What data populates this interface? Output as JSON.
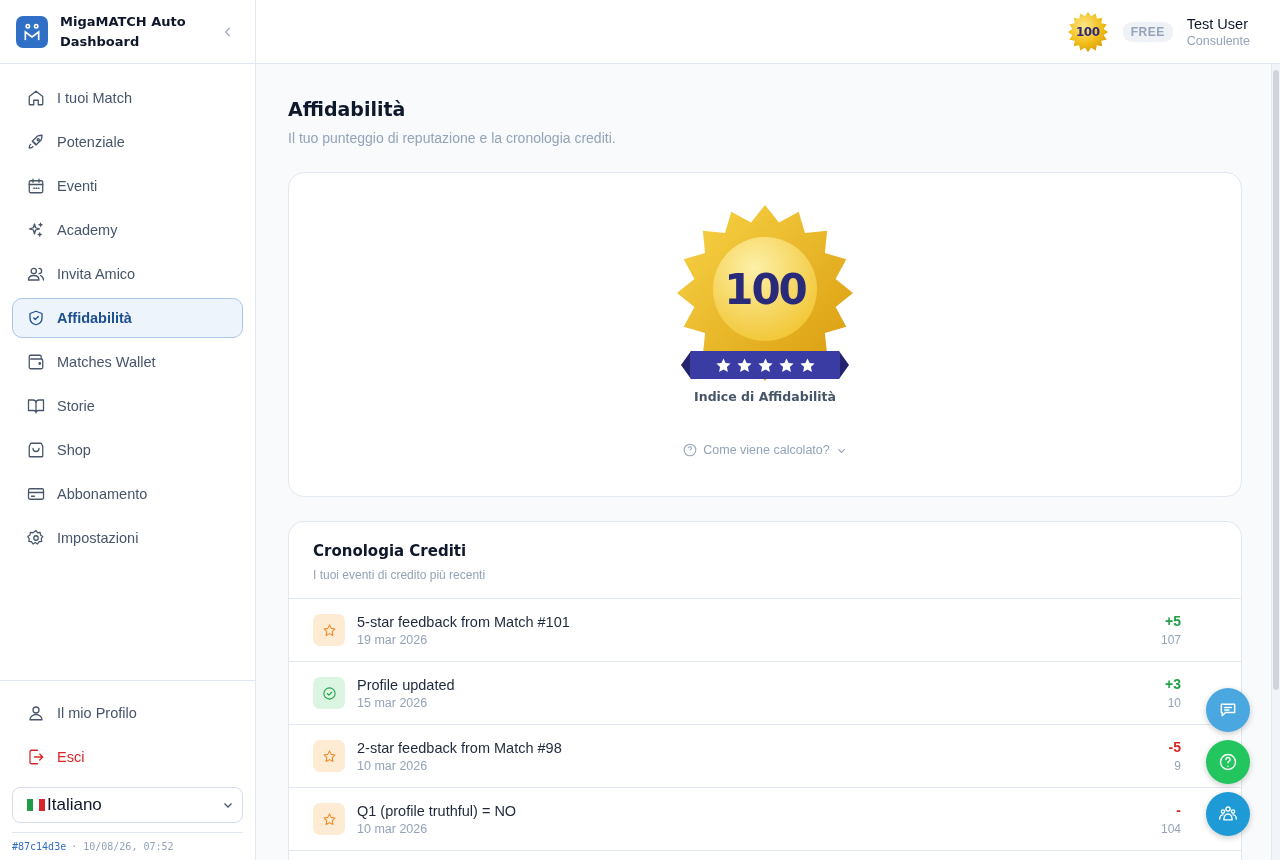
{
  "brand": {
    "title": "MigaMATCH Auto Dashboard"
  },
  "sidebar": {
    "items": [
      {
        "label": "I tuoi Match",
        "selected": false
      },
      {
        "label": "Potenziale",
        "selected": false
      },
      {
        "label": "Eventi",
        "selected": false
      },
      {
        "label": "Academy",
        "selected": false
      },
      {
        "label": "Invita Amico",
        "selected": false
      },
      {
        "label": "Affidabilità",
        "selected": true
      },
      {
        "label": "Matches Wallet",
        "selected": false
      },
      {
        "label": "Storie",
        "selected": false
      },
      {
        "label": "Shop",
        "selected": false
      },
      {
        "label": "Abbonamento",
        "selected": false
      },
      {
        "label": "Impostazioni",
        "selected": false
      }
    ],
    "bottom_items": [
      {
        "label": "Il mio Profilo",
        "kind": "profile"
      },
      {
        "label": "Esci",
        "kind": "logout"
      }
    ],
    "language": "Italiano",
    "build": {
      "hash": "#87c14d3e",
      "stamp": "· 10/08/26, 07:52"
    }
  },
  "header": {
    "score": "100",
    "plan": "FREE",
    "user": "Test User",
    "role": "Consulente"
  },
  "page": {
    "title": "Affidabilità",
    "subtitle": "Il tuo punteggio di reputazione e la cronologia crediti."
  },
  "score_card": {
    "score": "100",
    "stars": 5,
    "label": "Indice di Affidabilità",
    "help": "Come viene calcolato?"
  },
  "history": {
    "title": "Cronologia Crediti",
    "subtitle": "I tuoi eventi di credito più recenti",
    "rows": [
      {
        "kind": "star",
        "title": "5-star feedback from Match #101",
        "date": "19 mar 2026",
        "amount": "+5",
        "positive": true,
        "balance": "107"
      },
      {
        "kind": "check",
        "title": "Profile updated",
        "date": "15 mar 2026",
        "amount": "+3",
        "positive": true,
        "balance": "10"
      },
      {
        "kind": "star",
        "title": "2-star feedback from Match #98",
        "date": "10 mar 2026",
        "amount": "-5",
        "positive": false,
        "balance": "9"
      },
      {
        "kind": "star",
        "title": "Q1 (profile truthful) = NO",
        "date": "10 mar 2026",
        "amount": "-",
        "positive": false,
        "balance": "104"
      }
    ]
  }
}
